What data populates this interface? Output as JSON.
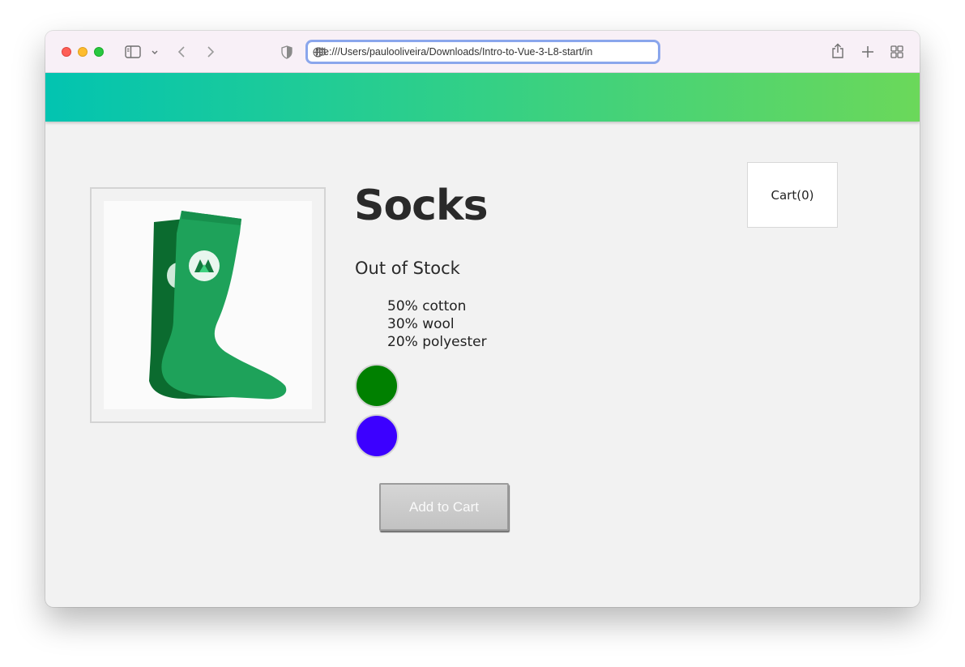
{
  "browser": {
    "url": "file:///Users/paulooliveira/Downloads/Intro-to-Vue-3-L8-start/in"
  },
  "nav": {
    "gradient_start": "#02c4b1",
    "gradient_end": "#6bd85a"
  },
  "cart": {
    "label": "Cart(0)"
  },
  "product": {
    "title": "Socks",
    "stock_status": "Out of Stock",
    "details": [
      "50% cotton",
      "30% wool",
      "20% polyester"
    ],
    "variants": [
      {
        "color": "#008000"
      },
      {
        "color": "#3c00ff"
      }
    ],
    "add_button_label": "Add to Cart",
    "add_button_state": "disabled"
  }
}
